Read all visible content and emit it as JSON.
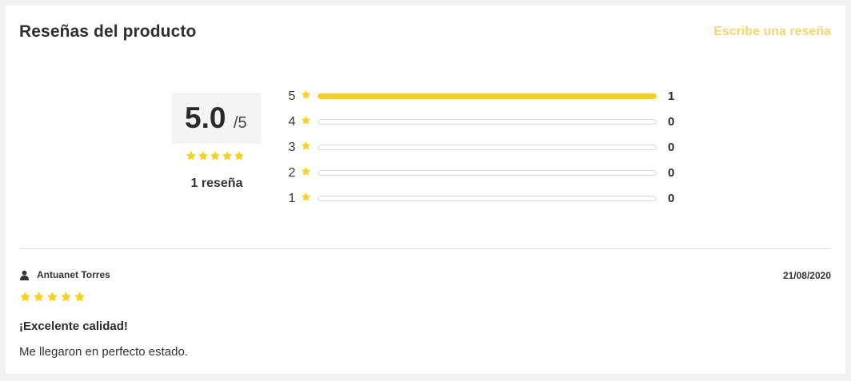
{
  "header": {
    "title": "Reseñas del producto",
    "write_review_label": "Escribe una reseña"
  },
  "summary": {
    "average": "5.0",
    "max": "/5",
    "average_stars": 5,
    "review_count_label": "1 reseña"
  },
  "distribution": [
    {
      "stars": "5",
      "count": "1",
      "fraction": 1.0
    },
    {
      "stars": "4",
      "count": "0",
      "fraction": 0
    },
    {
      "stars": "3",
      "count": "0",
      "fraction": 0
    },
    {
      "stars": "2",
      "count": "0",
      "fraction": 0
    },
    {
      "stars": "1",
      "count": "0",
      "fraction": 0
    }
  ],
  "reviews": [
    {
      "author": "Antuanet Torres",
      "date": "21/08/2020",
      "rating": 5,
      "title": "¡Excelente calidad!",
      "body": "Me llegaron en perfecto estado."
    }
  ],
  "colors": {
    "star": "#f7d11a",
    "link": "#f9d56e"
  },
  "icons": {
    "star": "star-icon",
    "user": "user-icon"
  }
}
